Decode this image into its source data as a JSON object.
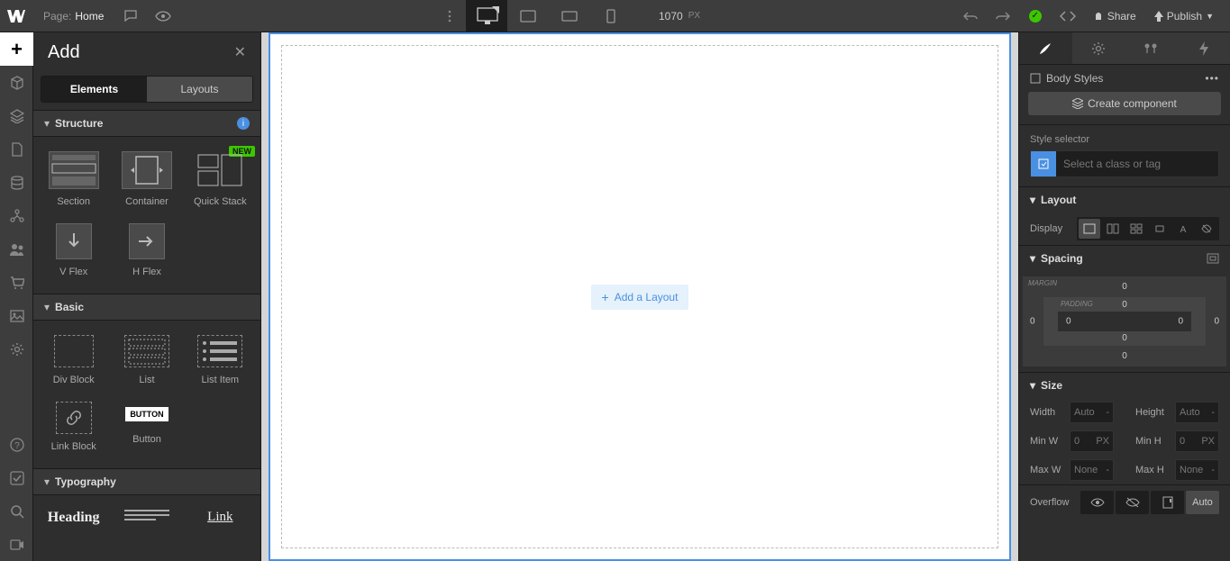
{
  "topbar": {
    "page_label": "Page:",
    "page_name": "Home",
    "px_width": "1070",
    "px_unit": "PX",
    "share": "Share",
    "publish": "Publish"
  },
  "add_panel": {
    "title": "Add",
    "tabs": {
      "elements": "Elements",
      "layouts": "Layouts"
    },
    "sections": {
      "structure": {
        "title": "Structure",
        "items": [
          {
            "name": "Section"
          },
          {
            "name": "Container"
          },
          {
            "name": "Quick Stack",
            "badge": "NEW"
          },
          {
            "name": "V Flex"
          },
          {
            "name": "H Flex"
          }
        ]
      },
      "basic": {
        "title": "Basic",
        "items": [
          {
            "name": "Div Block"
          },
          {
            "name": "List"
          },
          {
            "name": "List Item"
          },
          {
            "name": "Link Block"
          },
          {
            "name": "Button",
            "thumb_text": "BUTTON"
          }
        ]
      },
      "typography": {
        "title": "Typography",
        "items": [
          {
            "name": "Heading",
            "thumb_text": "Heading"
          },
          {
            "name": ""
          },
          {
            "name": "Link",
            "thumb_text": "Link"
          }
        ]
      }
    }
  },
  "canvas": {
    "add_layout": "Add a Layout"
  },
  "right_panel": {
    "body_styles": "Body Styles",
    "create_component": "Create component",
    "style_selector": "Style selector",
    "selector_placeholder": "Select a class or tag",
    "layout_title": "Layout",
    "display_label": "Display",
    "spacing_title": "Spacing",
    "margin_label": "MARGIN",
    "padding_label": "PADDING",
    "spacing_vals": {
      "mt": "0",
      "mr": "0",
      "mb": "0",
      "ml": "0",
      "pt": "0",
      "pr": "0",
      "pb": "0",
      "pl": "0"
    },
    "size_title": "Size",
    "width": {
      "label": "Width",
      "val": "Auto",
      "unit": "-"
    },
    "height": {
      "label": "Height",
      "val": "Auto",
      "unit": "-"
    },
    "minw": {
      "label": "Min W",
      "val": "0",
      "unit": "PX"
    },
    "minh": {
      "label": "Min H",
      "val": "0",
      "unit": "PX"
    },
    "maxw": {
      "label": "Max W",
      "val": "None",
      "unit": "-"
    },
    "maxh": {
      "label": "Max H",
      "val": "None",
      "unit": "-"
    },
    "overflow_label": "Overflow",
    "overflow_auto": "Auto"
  }
}
